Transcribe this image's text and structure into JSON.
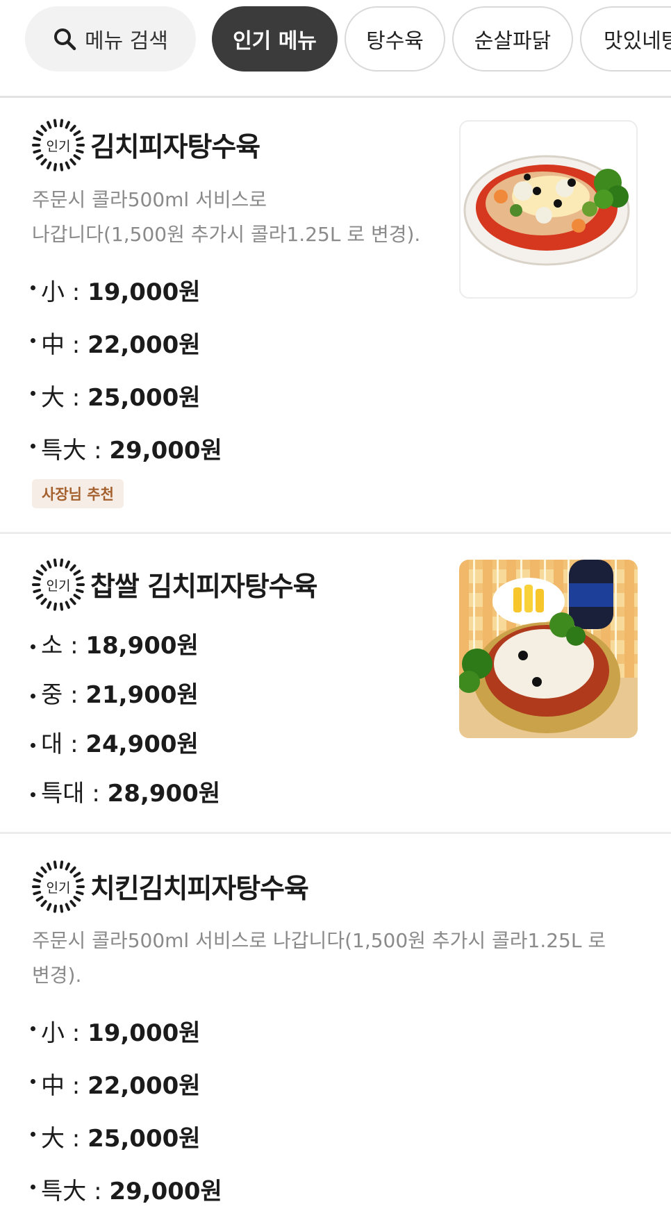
{
  "category_bar": {
    "search_label": "메뉴 검색",
    "search_icon": "search-icon",
    "tabs": [
      {
        "label": "인기 메뉴",
        "active": true
      },
      {
        "label": "탕수육",
        "active": false
      },
      {
        "label": "순살파닭",
        "active": false
      },
      {
        "label": "맛있네탕",
        "active": false
      }
    ]
  },
  "colors": {
    "active_chip": "#3b3b3b",
    "tag_bg": "#f6ede6",
    "tag_text": "#a4602d",
    "description_text": "#8a8a8a"
  },
  "menu_items": [
    {
      "badge": "인기",
      "name": "김치피자탕수육",
      "description_lines": [
        "주문시 콜라500ml 서비스로",
        "나갑니다(1,500원 추가시 콜라1.25L 로 변경)."
      ],
      "prices": [
        {
          "size": "小 : ",
          "price": "19,000원"
        },
        {
          "size": "中 : ",
          "price": "22,000원"
        },
        {
          "size": "大 : ",
          "price": "25,000원"
        },
        {
          "size": "특大 : ",
          "price": "29,000원"
        }
      ],
      "tag": "사장님 추천",
      "image_icon": "food-photo-icon"
    },
    {
      "badge": "인기",
      "name": "찹쌀 김치피자탕수육",
      "prices": [
        {
          "size": "소 : ",
          "price": "18,900원"
        },
        {
          "size": "중 : ",
          "price": "21,900원"
        },
        {
          "size": "대 : ",
          "price": "24,900원"
        },
        {
          "size": "특대 : ",
          "price": "28,900원"
        }
      ],
      "image_icon": "food-photo-icon"
    },
    {
      "badge": "인기",
      "name": "치킨김치피자탕수육",
      "description_lines": [
        "주문시 콜라500ml 서비스로 나갑니다(1,500원 추가시 콜라1.25L 로",
        "변경)."
      ],
      "prices": [
        {
          "size": "小 : ",
          "price": "19,000원"
        },
        {
          "size": "中 : ",
          "price": "22,000원"
        },
        {
          "size": "大 : ",
          "price": "25,000원"
        },
        {
          "size": "특大 : ",
          "price": "29,000원"
        }
      ]
    }
  ]
}
